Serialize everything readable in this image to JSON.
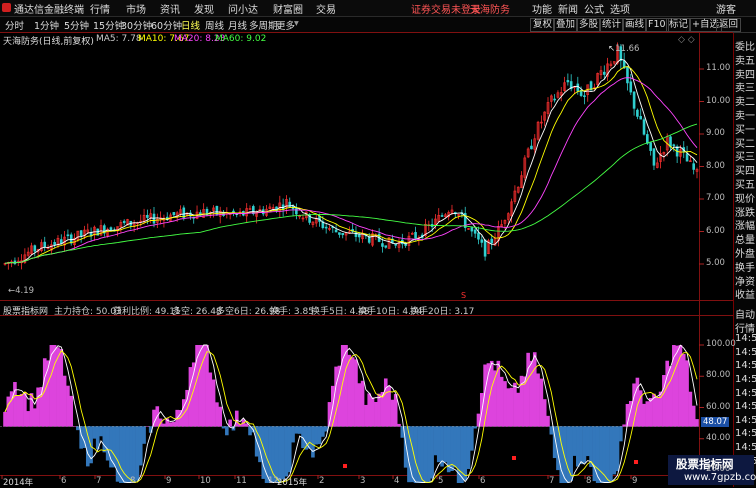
{
  "app": {
    "title": "通达信金融终端",
    "menu": [
      "行情",
      "市场",
      "资讯",
      "发现",
      "问小达",
      "财富圈",
      "交易"
    ],
    "status": "证券交易未登录",
    "stock_name_top": "天海防务",
    "right_menu": [
      "功能",
      "新闻",
      "公式",
      "选项"
    ],
    "guest": "游客"
  },
  "toolbar": {
    "periods": [
      "分时",
      "1分钟",
      "5分钟",
      "15分钟",
      "30分钟",
      "60分钟",
      "日线",
      "周线",
      "月线",
      "多周期",
      "更多"
    ],
    "tools": [
      "复权",
      "叠加",
      "多股",
      "统计",
      "画线",
      "F10",
      "标记",
      "+自选",
      "返回"
    ]
  },
  "main_chart": {
    "caption": "天海防务(日线,前复权)",
    "ma": [
      {
        "label": "MA5: 7.78",
        "color": "#ffffff"
      },
      {
        "label": "MA10: 7.67",
        "color": "#ffff00"
      },
      {
        "label": "MA20: 8.23",
        "color": "#ff44ff"
      },
      {
        "label": "MA60: 9.02",
        "color": "#44ff44"
      }
    ],
    "y_ticks": [
      "11.00",
      "10.00",
      "9.00",
      "8.00",
      "7.00",
      "6.00",
      "5.00"
    ],
    "high_label": "11.66",
    "low_label": "4.19"
  },
  "indicator": {
    "name": "股票指标网",
    "items": [
      {
        "label": "主力持仓: 50.03",
        "color": "#ff4444"
      },
      {
        "label": "获利比例: 49.11",
        "color": "#ffff00"
      },
      {
        "label": "多空: 26.48",
        "color": "#ffffff"
      },
      {
        "label": "多空6日: 26.98",
        "color": "#ffff00"
      },
      {
        "label": "换手: 3.85",
        "color": "#aaaaaa"
      },
      {
        "label": "换手5日: 4.48",
        "color": "#4466ff"
      },
      {
        "label": "换手10日: 4.04",
        "color": "#ffffff"
      },
      {
        "label": "换手20日: 3.17",
        "color": "#ffff00"
      }
    ],
    "y_ticks": [
      "100.00",
      "80.00",
      "60.00",
      "40.00",
      "20.00"
    ],
    "current_value": "48.07"
  },
  "right_panel": {
    "quote_rows": [
      "委比",
      "卖五",
      "卖四",
      "卖三",
      "卖二",
      "卖一",
      "买一",
      "买二",
      "买三",
      "买四",
      "买五",
      "现价",
      "涨跌",
      "涨幅",
      "总量",
      "外盘",
      "换手",
      "净资",
      "收益"
    ],
    "bottom_rows": [
      "自动",
      "行情",
      "14:5",
      "14:5",
      "14:5",
      "14:5",
      "14:5",
      "14:5",
      "14:5",
      "14:5",
      "14:5",
      "14:5"
    ]
  },
  "x_axis": [
    "2014年",
    "6",
    "7",
    "8",
    "9",
    "10",
    "11",
    "12",
    "2015年",
    "2",
    "3",
    "4",
    "5",
    "6",
    "7",
    "8",
    "9"
  ],
  "watermark": {
    "title": "股票指标网",
    "url": "www.7gpzb.com"
  },
  "colors": {
    "up": "#ff3030",
    "down": "#30d0d0",
    "magenta": "#dd44dd",
    "blue": "#3377bb"
  }
}
